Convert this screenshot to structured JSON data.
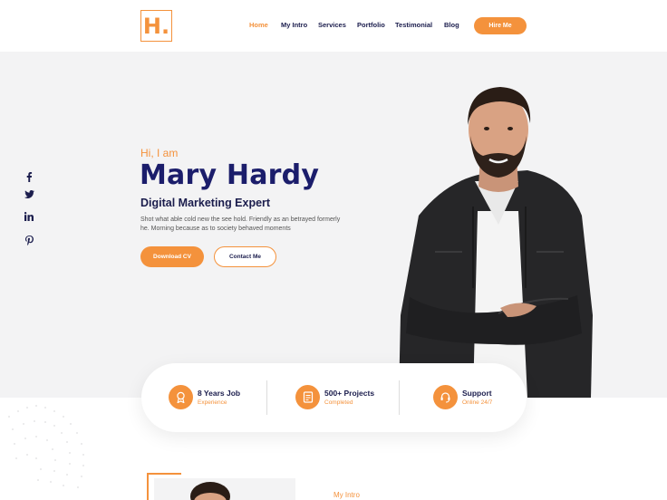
{
  "header": {
    "logo": "H.",
    "nav": [
      {
        "label": "Home"
      },
      {
        "label": "My Intro"
      },
      {
        "label": "Services"
      },
      {
        "label": "Portfolio"
      },
      {
        "label": "Testimonial"
      },
      {
        "label": "Blog"
      }
    ],
    "hire_label": "Hire Me"
  },
  "social": [
    "facebook-icon",
    "twitter-icon",
    "linkedin-icon",
    "pinterest-icon"
  ],
  "hero": {
    "greeting": "Hi, I am",
    "name": "Mary Hardy",
    "role": "Digital Marketing Expert",
    "description": "Shot what able cold new the see hold. Friendly as an betrayed formerly he. Morning because as to society behaved moments",
    "download_label": "Download CV",
    "contact_label": "Contact Me"
  },
  "stats": [
    {
      "title": "8 Years Job",
      "subtitle": "Experience",
      "icon": "award-icon"
    },
    {
      "title": "500+ Projects",
      "subtitle": "Completed",
      "icon": "document-icon"
    },
    {
      "title": "Support",
      "subtitle": "Online 24/7",
      "icon": "support-icon"
    }
  ],
  "intro": {
    "label": "My Intro"
  },
  "colors": {
    "accent": "#f4923c",
    "navy": "#1b1d6b",
    "hero_bg": "#f3f3f4"
  }
}
